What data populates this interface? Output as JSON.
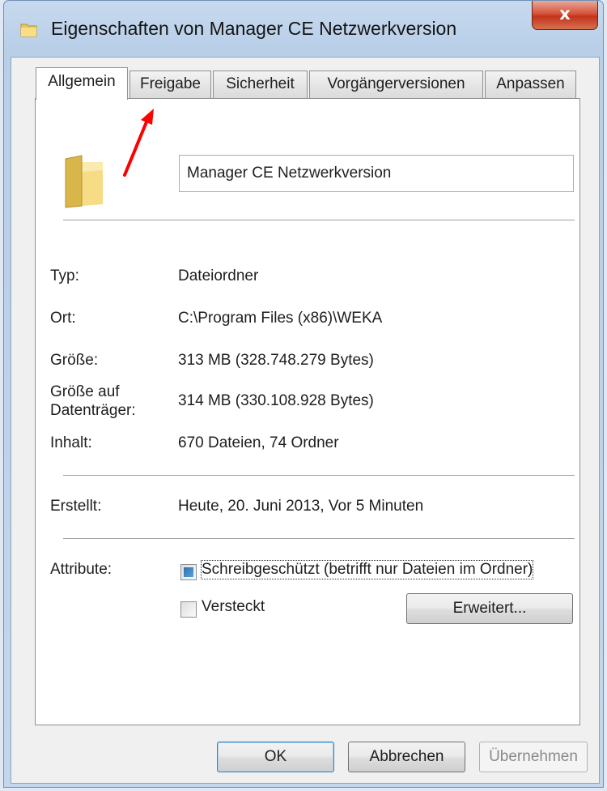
{
  "window": {
    "title": "Eigenschaften von Manager CE Netzwerkversion",
    "close_label": "x"
  },
  "tabs": [
    {
      "label": "Allgemein",
      "active": true
    },
    {
      "label": "Freigabe",
      "active": false
    },
    {
      "label": "Sicherheit",
      "active": false
    },
    {
      "label": "Vorgängerversionen",
      "active": false
    },
    {
      "label": "Anpassen",
      "active": false
    }
  ],
  "general": {
    "name": "Manager CE Netzwerkversion",
    "props": [
      {
        "label": "Typ:",
        "value": "Dateiordner"
      },
      {
        "label": "Ort:",
        "value": "C:\\Program Files (x86)\\WEKA"
      },
      {
        "label": "Größe:",
        "value": "313 MB (328.748.279 Bytes)"
      },
      {
        "label_line1": "Größe auf",
        "label_line2": "Datenträger:",
        "value": "314 MB (330.108.928 Bytes)"
      },
      {
        "label": "Inhalt:",
        "value": "670 Dateien, 74 Ordner"
      }
    ],
    "created_label": "Erstellt:",
    "created_value": "Heute, 20. Juni 2013, Vor 5 Minuten",
    "attributes_label": "Attribute:",
    "readonly_label": "Schreibgeschützt (betrifft nur Dateien im Ordner)",
    "readonly_state": "indeterminate",
    "hidden_label": "Versteckt",
    "hidden_state": "unchecked",
    "advanced_button": "Erweitert..."
  },
  "footer": {
    "ok": "OK",
    "cancel": "Abbrechen",
    "apply": "Übernehmen"
  },
  "colors": {
    "annotation_arrow": "#ff0000",
    "folder": "#f2d36b"
  }
}
